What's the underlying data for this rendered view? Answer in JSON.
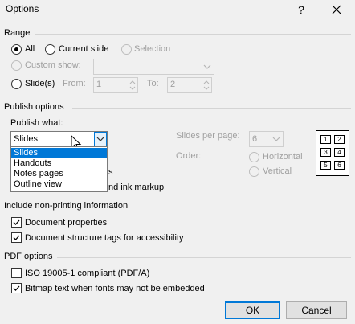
{
  "window": {
    "title": "Options",
    "help_label": "?"
  },
  "range": {
    "label": "Range",
    "all": "All",
    "current_slide": "Current slide",
    "selection": "Selection",
    "custom_show": "Custom show:",
    "slides": "Slide(s)",
    "from_label": "From:",
    "from_value": "1",
    "to_label": "To:",
    "to_value": "2"
  },
  "publish": {
    "label": "Publish options",
    "what_label": "Publish what:",
    "what_value": "Slides",
    "slides_per_page_label": "Slides per page:",
    "slides_per_page_value": "6",
    "order_label": "Order:",
    "horizontal": "Horizontal",
    "vertical": "Vertical",
    "dropdown_options": [
      "Slides",
      "Handouts",
      "Notes pages",
      "Outline view"
    ],
    "hidden_text_1": "s",
    "hidden_text_2": "nd ink markup",
    "preview_numbers": [
      "1",
      "2",
      "3",
      "4",
      "5",
      "6"
    ]
  },
  "nonprinting": {
    "label": "Include non-printing information",
    "doc_props": "Document properties",
    "doc_tags": "Document structure tags for accessibility"
  },
  "pdf": {
    "label": "PDF options",
    "iso": "ISO 19005-1 compliant (PDF/A)",
    "bitmap": "Bitmap text when fonts may not be embedded"
  },
  "buttons": {
    "ok": "OK",
    "cancel": "Cancel"
  }
}
